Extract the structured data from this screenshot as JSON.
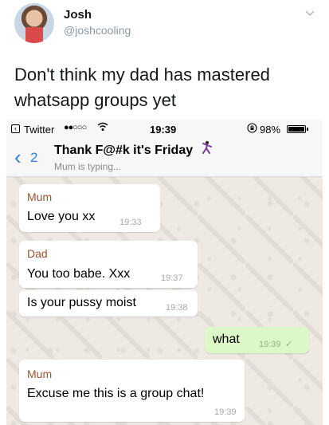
{
  "tweet": {
    "name": "Josh",
    "handle": "@joshcooling",
    "text": "Don't think my dad has mastered whatsapp groups yet",
    "icons": {
      "avatar": "user-avatar",
      "menu": "chevron-down-icon"
    }
  },
  "status_bar": {
    "back_app": "Twitter",
    "signal": "●●○○○",
    "time": "19:39",
    "battery_percent_text": "98%",
    "battery_level": 0.98,
    "icons": {
      "wifi": "wifi-icon",
      "rotation_lock": "rotation-lock-icon"
    }
  },
  "chat_header": {
    "back_count": "2",
    "title": "Thank F@#k it's Friday",
    "title_emoji": "dancer-emoji",
    "subtitle": "Mum is typing..."
  },
  "messages": [
    {
      "sender": "Mum",
      "text": "Love you xx",
      "time": "19:33",
      "direction": "in"
    },
    {
      "sender": "Dad",
      "text": "You too babe. Xxx",
      "time": "19:37",
      "direction": "in"
    },
    {
      "sender": "",
      "text": "Is your pussy moist",
      "time": "19:38",
      "direction": "in"
    },
    {
      "sender": "",
      "text": "what",
      "time": "19:39",
      "direction": "out",
      "read_tick": "✓"
    },
    {
      "sender": "Mum",
      "text": "Excuse me this is a group chat!",
      "time": "19:39",
      "direction": "in"
    }
  ],
  "colors": {
    "link_blue": "#2a7fe0",
    "outgoing_bubble": "#dcf8c6",
    "sender_name": "#a0522d",
    "chat_bg": "#efe9e3"
  }
}
